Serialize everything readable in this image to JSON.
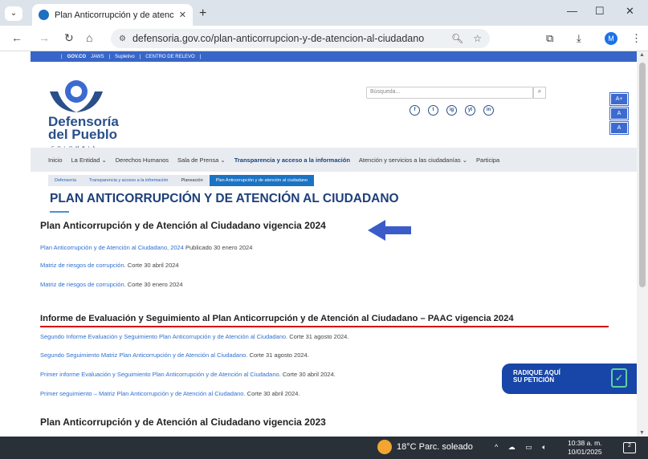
{
  "browser": {
    "tab_title": "Plan Anticorrupción y de atenci",
    "tab_close": "✕",
    "new_tab": "+",
    "url": "defensoria.gov.co/plan-anticorrupcion-y-de-atencion-al-ciudadano",
    "profile_initial": "M",
    "window_controls": {
      "min": "—",
      "max": "☐",
      "close": "✕"
    }
  },
  "gov_bar": {
    "items": [
      "|",
      "GOV.CO",
      "JAWS",
      "|",
      "Supletivo",
      "|",
      "CENTRO DE RELEVO",
      "|"
    ]
  },
  "header": {
    "logo_name": "Defensoría del Pueblo",
    "logo_country": "COLOMBIA",
    "search_placeholder": "Búsqueda...",
    "social": [
      "f",
      "t",
      "ig",
      "yt",
      "in"
    ],
    "font_buttons": [
      "A+",
      "A",
      "A"
    ]
  },
  "nav": {
    "items": [
      "Inicio",
      "La Entidad ⌄",
      "Derechos Humanos",
      "Sala de Prensa ⌄",
      "Transparencia y acceso a la información",
      "Atención y servicios a las ciudadanías ⌄",
      "Participa"
    ],
    "active_index": 4
  },
  "breadcrumb": [
    "Defensoría",
    "Transparencia y acceso a la información",
    "Planeación",
    "Plan Anticorrupción y de atención al ciudadano"
  ],
  "page_title": "PLAN ANTICORRUPCIÓN Y DE ATENCIÓN AL CIUDADANO",
  "sections": [
    {
      "heading": "Plan Anticorrupción y de Atención al Ciudadano vigencia 2024",
      "items": [
        {
          "link": "Plan Anticorrupción y de Atención al Ciudadano, 2024",
          "note": " Publicado 30 enero 2024"
        },
        {
          "link": "Matriz de riesgos de corrupción.",
          "note": " Corte 30 abril 2024"
        },
        {
          "link": "Matriz de riesgos de corrupción.",
          "note": " Corte 30 enero 2024"
        }
      ]
    },
    {
      "heading": "Informe de Evaluación y Seguimiento al Plan Anticorrupción y de Atención al Ciudadano – PAAC vigencia 2024",
      "items": [
        {
          "link": "Segundo Informe Evaluación y Seguimiento Plan Anticorrupción y de Atención al Ciudadano.",
          "note": " Corte 31 agosto 2024."
        },
        {
          "link": "Segundo Seguimiento Matriz Plan Anticorrupción y de Atención al Ciudadano.",
          "note": " Corte 31 agosto 2024."
        },
        {
          "link": "Primer informe Evaluación y Seguimiento Plan Anticorrupción y de Atención al Ciudadano.",
          "note": " Corte 30 abril 2024."
        },
        {
          "link": "Primer seguimiento – Matriz Plan Anticorrupción y de Atención al Ciudadano.",
          "note": " Corte 30 abril 2024."
        }
      ]
    },
    {
      "heading": "Plan Anticorrupción y de Atención al Ciudadano vigencia 2023",
      "items": []
    }
  ],
  "radique": {
    "line1": "RADIQUE AQUÍ",
    "line2": "SU PETICIÓN"
  },
  "taskbar": {
    "weather": "18°C  Parc. soleado",
    "time": "10:38 a. m.",
    "date": "10/01/2025",
    "notif": "2"
  },
  "colors": {
    "brand": "#1d3f7a",
    "link": "#2e6fd0",
    "accent_red": "#d40000",
    "arrow": "#3b5cc8"
  }
}
